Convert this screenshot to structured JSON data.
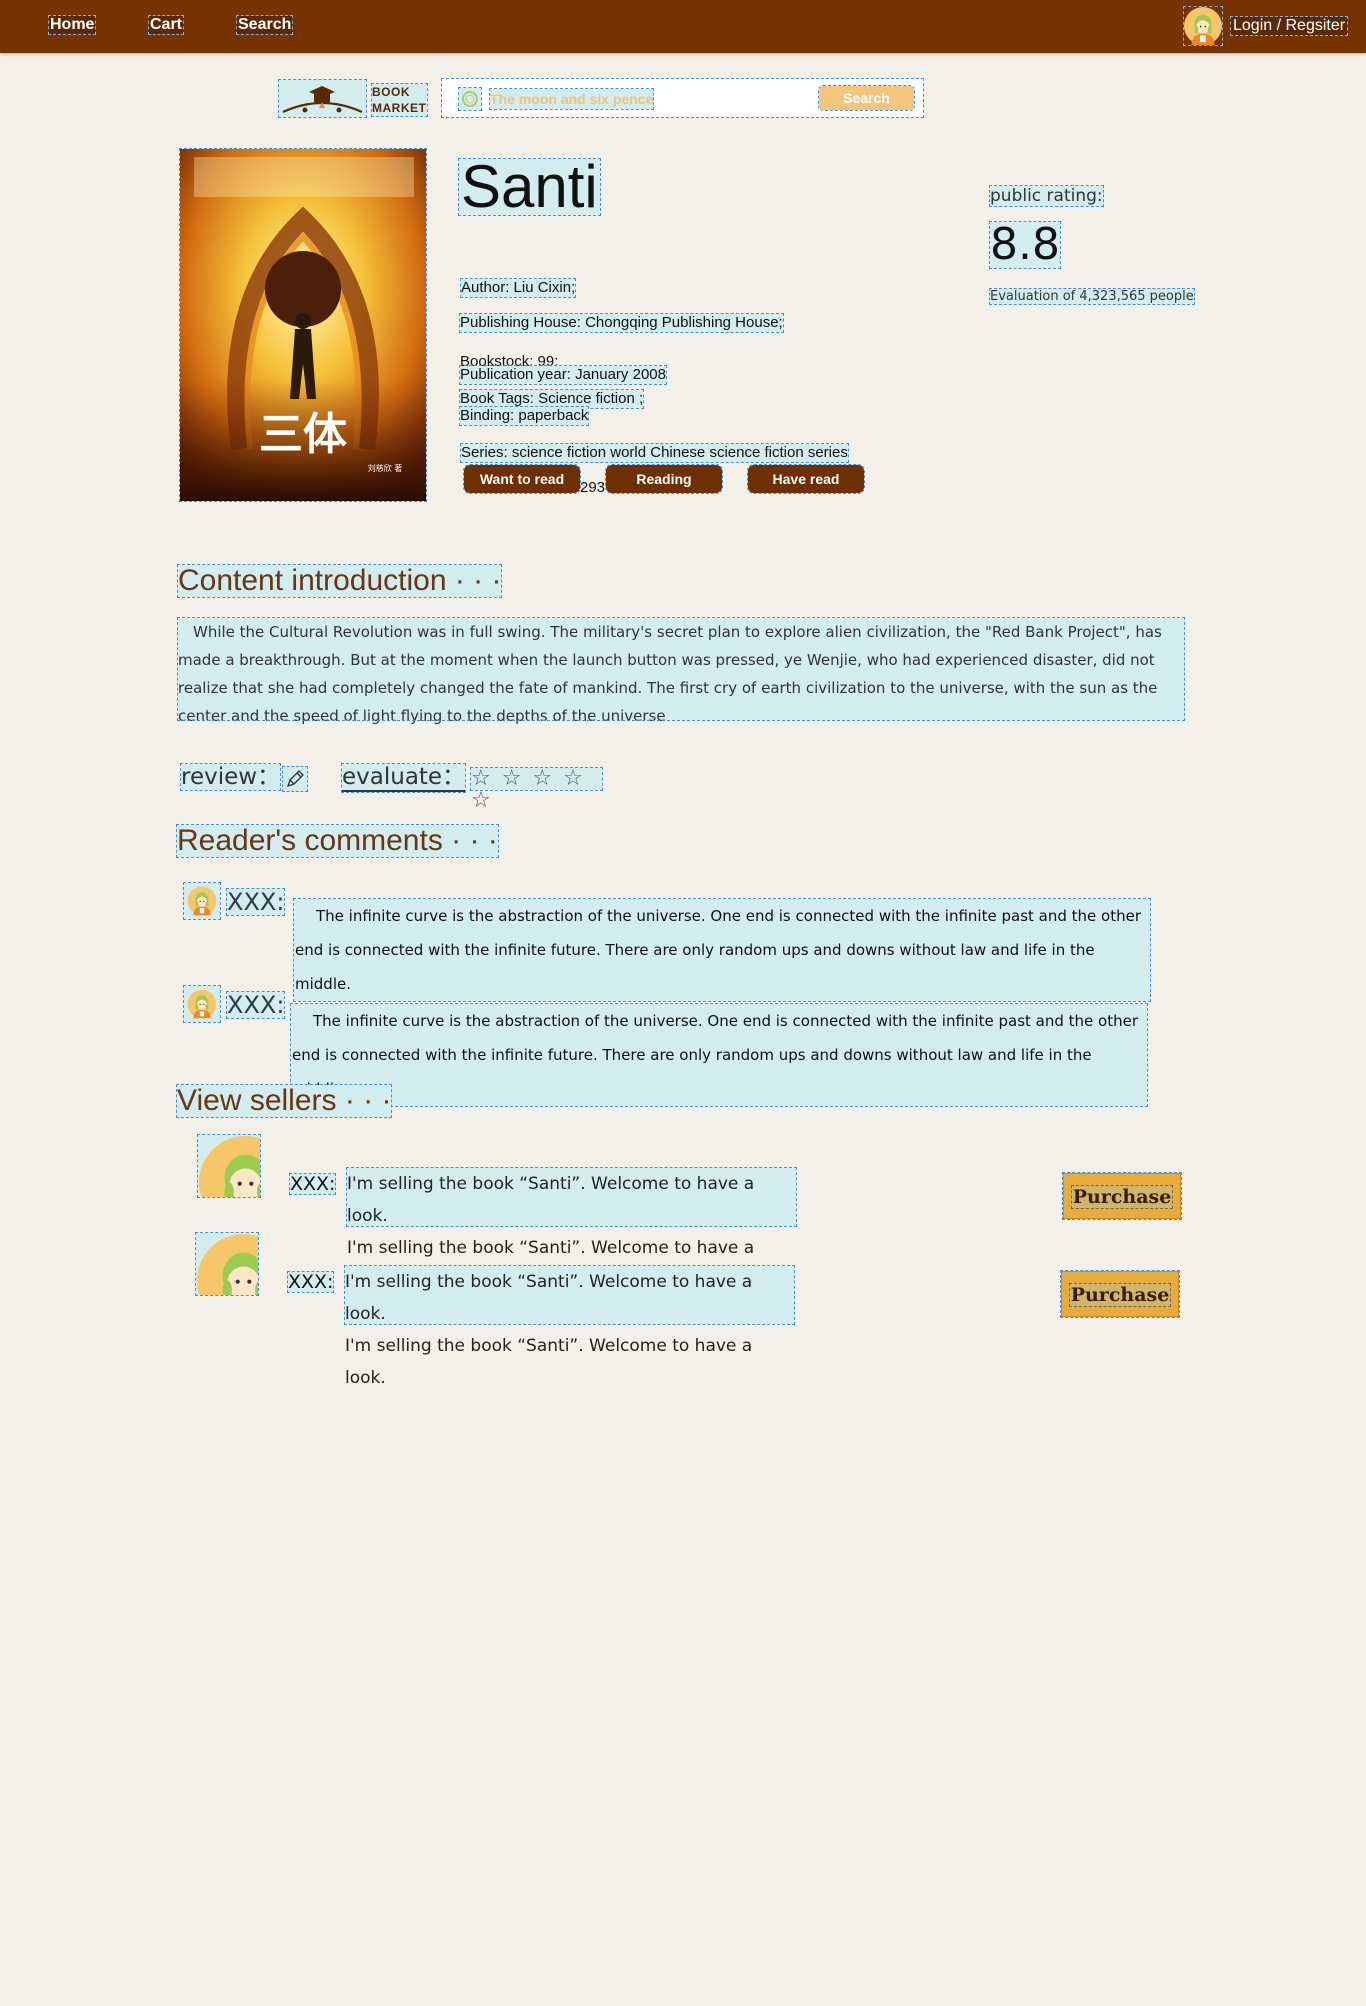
{
  "nav": {
    "home": "Home",
    "cart": "Cart",
    "search": "Search",
    "login": "Login / Regsiter"
  },
  "logo": {
    "line1": "BOOK",
    "line2": "MARKET"
  },
  "search": {
    "placeholder": "The moon and six pence",
    "button": "Search"
  },
  "book": {
    "title": "Santi",
    "author": "Author: Liu Cixin;",
    "publisher": "Publishing House: Chongqing Publishing House;",
    "bookstock": "Bookstock: 99;",
    "pub_year": "Publication year: January 2008",
    "tags": "Book Tags: Science fiction ;",
    "binding": "Binding: paperback",
    "series": "Series: science fiction world Chinese science fiction series",
    "isbn_partial": "293",
    "cover_title": "三体",
    "cover_author": "刘慈欣 著"
  },
  "rating": {
    "label": "public rating:",
    "value": "8.8",
    "count": "Evaluation of 4,323,565 people"
  },
  "actions": {
    "want": "Want to read",
    "reading": "Reading",
    "read": "Have read"
  },
  "intro": {
    "heading": "Content introduction · · ·",
    "text": "While the Cultural Revolution was in full swing. The military's secret plan to explore alien civilization, the \"Red Bank Project\", has made a breakthrough. But at the moment when the launch button was pressed, ye Wenjie, who had experienced disaster, did not realize that she had completely changed the fate of mankind. The first cry of earth civilization to the universe, with the sun as the center and the speed of light flying to the depths of the universe"
  },
  "review": {
    "review_label": "review：",
    "evaluate_label": "evaluate：",
    "stars": "☆ ☆ ☆ ☆ ☆",
    "star_rating": 0
  },
  "comments": {
    "heading": "Reader's comments · · ·",
    "items": [
      {
        "name": "XXX:",
        "text": "The infinite curve is the abstraction of the universe. One end is connected with the infinite past and the other end is connected with the infinite future. There are only random ups and downs without law and life in the middle."
      },
      {
        "name": "XXX:",
        "text": "The infinite curve is the abstraction of the universe. One end is connected with the infinite past and the other end is connected with the infinite future. There are only random ups and downs without law and life in the middle."
      }
    ]
  },
  "sellers": {
    "heading": "View  sellers · · ·",
    "items": [
      {
        "name": "XXX:",
        "line1": "I'm selling the book “Santi”. Welcome to have a look.",
        "line2": "I'm selling the book “Santi”. Welcome to have a look.",
        "button": "Purchase"
      },
      {
        "name": "XXX:",
        "line1": "I'm selling the book “Santi”. Welcome to have a look.",
        "line2": "I'm selling the book “Santi”. Welcome to have a look.",
        "button": "Purchase"
      }
    ]
  },
  "colors": {
    "header": "#763300",
    "background": "#f3f0ea",
    "accent": "#e8ab3d",
    "heading": "#6b3413",
    "highlight": "#d3ecee"
  }
}
